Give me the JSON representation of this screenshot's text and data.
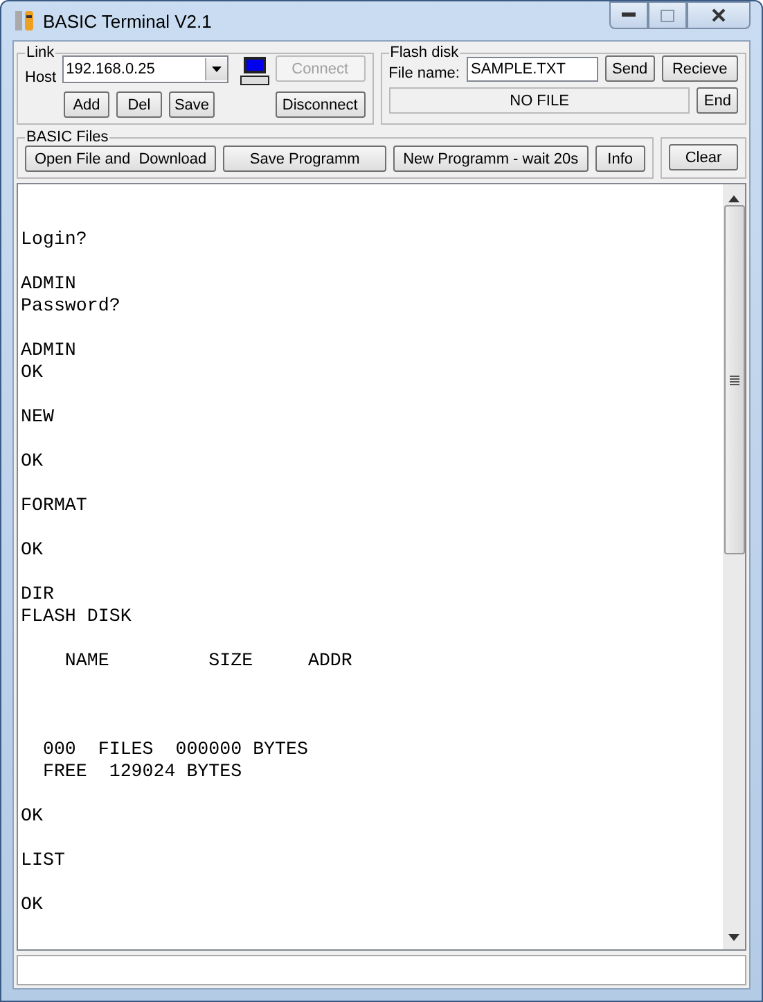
{
  "window": {
    "title": "BASIC Terminal V2.1"
  },
  "link": {
    "label": "Link",
    "host_label": "Host",
    "host": "192.168.0.25",
    "buttons": [
      "Add",
      "Del",
      "Save"
    ],
    "connect": {
      "label": "Connect",
      "disabled": true
    },
    "disconnect": "Disconnect"
  },
  "flash_disk": {
    "label": "Flash disk",
    "file_label": "File name:",
    "file_name": "SAMPLE.TXT",
    "send": "Send",
    "receive": "Recieve",
    "status": "NO FILE",
    "end": "End"
  },
  "basic_files": {
    "label": "BASIC Files",
    "buttons": [
      "Open File and  Download",
      "Save Programm",
      "New Programm - wait 20s",
      "Info"
    ]
  },
  "clear": "Clear",
  "terminal": {
    "text": "\n\nLogin?\n\nADMIN\nPassword?\n\nADMIN\nOK\n\nNEW\n\nOK\n\nFORMAT\n\nOK\n\nDIR\nFLASH DISK\n\n    NAME         SIZE     ADDR\n\n\n\n  000  FILES  000000 BYTES\n  FREE  129024 BYTES\n\nOK\n\nLIST\n\nOK"
  }
}
